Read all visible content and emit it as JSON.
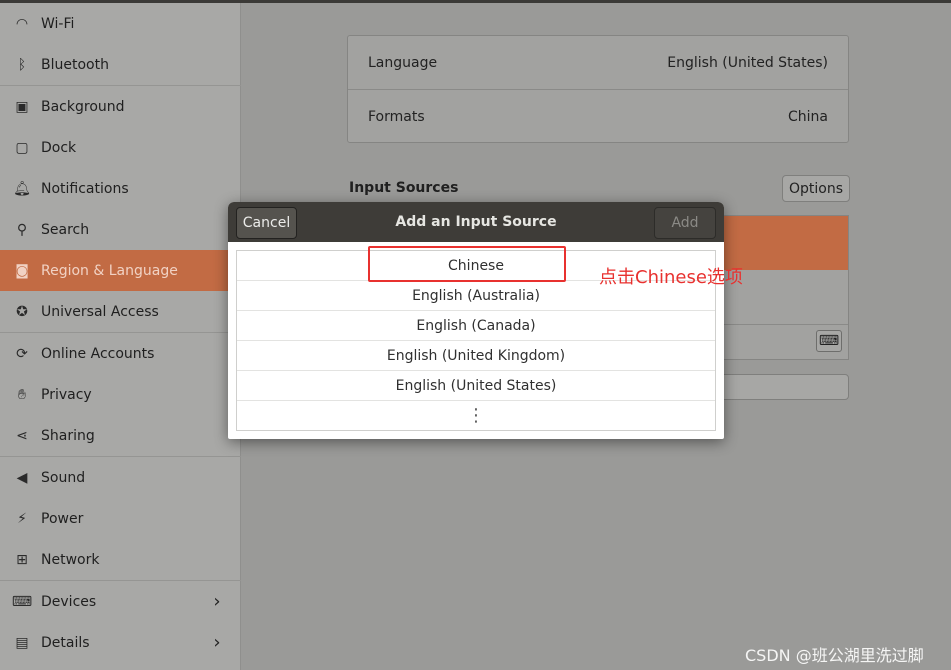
{
  "sidebar": {
    "items": [
      {
        "label": "Wi-Fi",
        "icon": "wifi-icon",
        "glyph": "◠"
      },
      {
        "label": "Bluetooth",
        "icon": "bluetooth-icon",
        "glyph": "ᛒ"
      },
      {
        "label": "Background",
        "icon": "background-icon",
        "glyph": "▣"
      },
      {
        "label": "Dock",
        "icon": "dock-icon",
        "glyph": "▢"
      },
      {
        "label": "Notifications",
        "icon": "bell-icon",
        "glyph": "🔔︎"
      },
      {
        "label": "Search",
        "icon": "search-icon",
        "glyph": "⚲"
      },
      {
        "label": "Region & Language",
        "icon": "camera-icon",
        "glyph": "◙"
      },
      {
        "label": "Universal Access",
        "icon": "accessibility-icon",
        "glyph": "✪"
      },
      {
        "label": "Online Accounts",
        "icon": "online-accounts-icon",
        "glyph": "⟳"
      },
      {
        "label": "Privacy",
        "icon": "hand-icon",
        "glyph": "✋︎"
      },
      {
        "label": "Sharing",
        "icon": "share-icon",
        "glyph": "⋖"
      },
      {
        "label": "Sound",
        "icon": "speaker-icon",
        "glyph": "◀"
      },
      {
        "label": "Power",
        "icon": "power-icon",
        "glyph": "⚡︎"
      },
      {
        "label": "Network",
        "icon": "network-icon",
        "glyph": "⊞"
      },
      {
        "label": "Devices",
        "icon": "devices-icon",
        "glyph": "⌨"
      },
      {
        "label": "Details",
        "icon": "details-icon",
        "glyph": "▤"
      }
    ],
    "active_index": 6,
    "chevron": "›"
  },
  "main": {
    "language_label": "Language",
    "language_value": "English (United States)",
    "formats_label": "Formats",
    "formats_value": "China",
    "input_sources_title": "Input Sources",
    "options_label": "Options",
    "keyboard_glyph": "⌨"
  },
  "dialog": {
    "title": "Add an Input Source",
    "cancel_label": "Cancel",
    "add_label": "Add",
    "items": [
      "Chinese",
      "English (Australia)",
      "English (Canada)",
      "English (United Kingdom)",
      "English (United States)"
    ],
    "more_glyph": "⋮"
  },
  "annotation": {
    "text": "点击Chinese选项",
    "color": "#e8312f"
  },
  "watermark": "CSDN @班公湖里洗过脚",
  "colors": {
    "accent": "#c26b44",
    "dialog_header": "#3e3c38"
  }
}
